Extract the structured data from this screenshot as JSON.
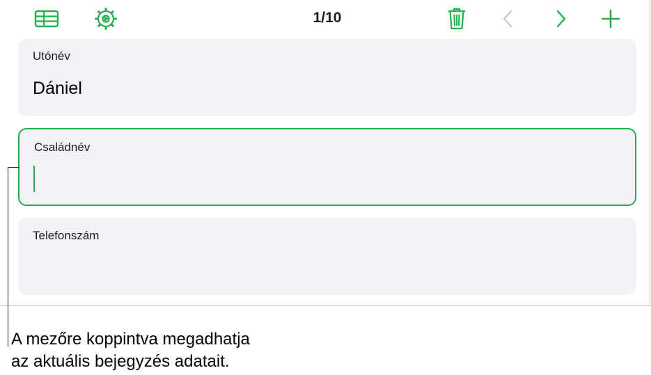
{
  "toolbar": {
    "record_counter": "1/10",
    "icons": [
      "table-icon",
      "settings-gear-icon",
      "trash-icon",
      "chevron-left-icon",
      "chevron-right-icon",
      "plus-icon"
    ],
    "accent_color": "#21b04b",
    "disabled_color": "#c7c7cc"
  },
  "fields": [
    {
      "label": "Utónév",
      "value": "Dániel",
      "active": false
    },
    {
      "label": "Családnév",
      "value": "",
      "active": true
    },
    {
      "label": "Telefonszám",
      "value": "",
      "active": false
    }
  ],
  "callout": {
    "line1": "A mezőre koppintva megadhatja",
    "line2": "az aktuális bejegyzés adatait."
  }
}
